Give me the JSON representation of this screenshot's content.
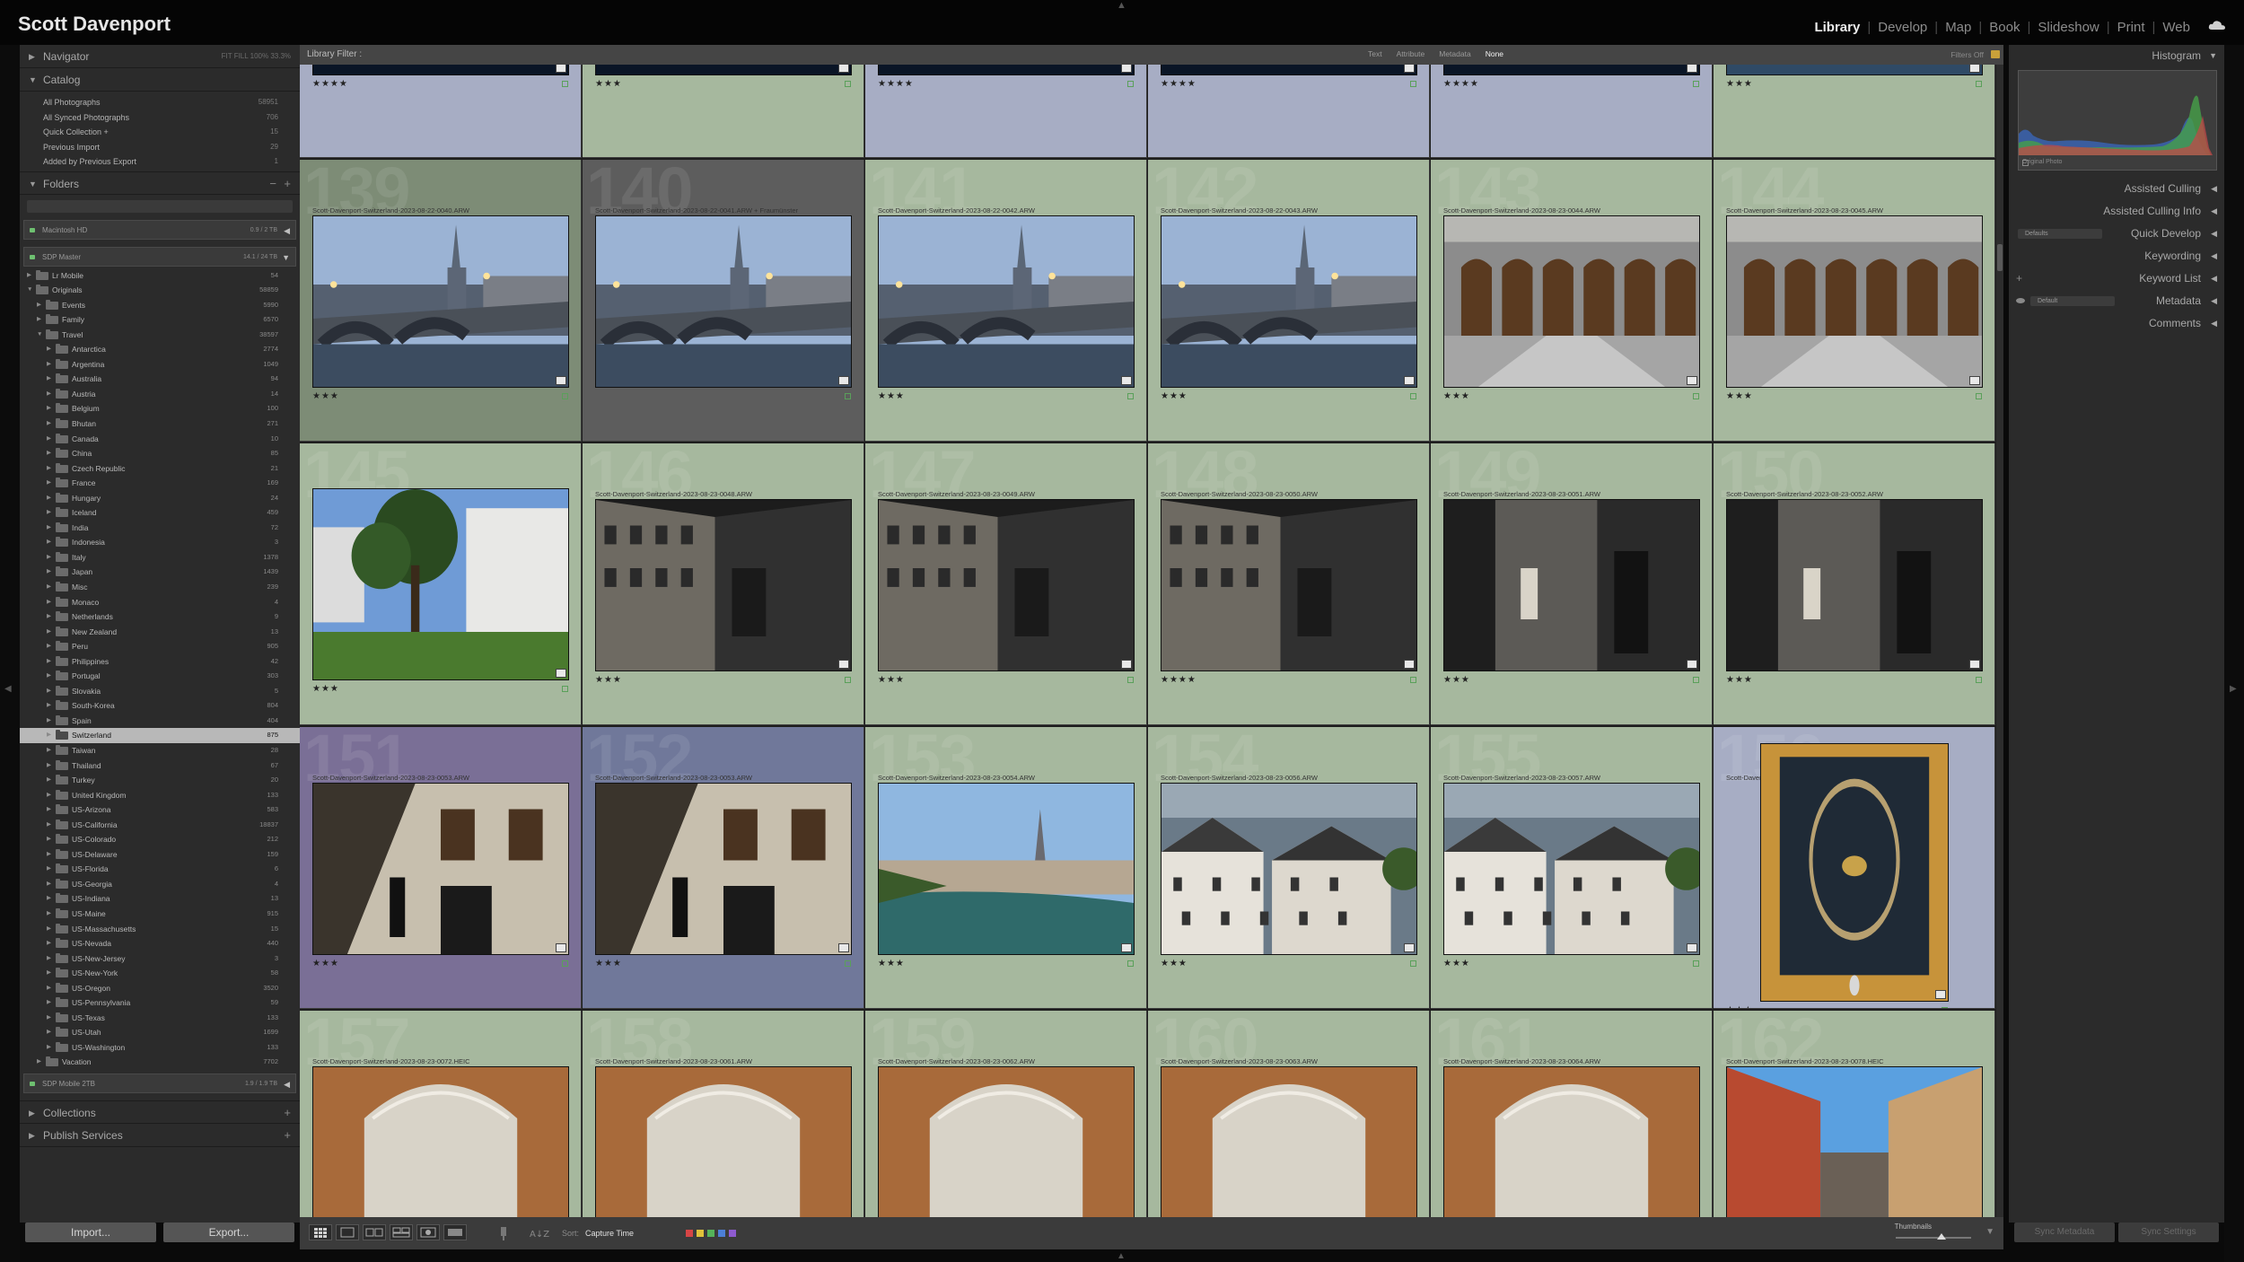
{
  "identity": "Scott Davenport",
  "modules": [
    {
      "label": "Library",
      "active": true
    },
    {
      "label": "Develop"
    },
    {
      "label": "Map"
    },
    {
      "label": "Book"
    },
    {
      "label": "Slideshow"
    },
    {
      "label": "Print"
    },
    {
      "label": "Web"
    }
  ],
  "left_panel": {
    "navigator": {
      "label": "Navigator",
      "zoom": "FIT  FILL  100%  33.3%"
    },
    "catalog": {
      "label": "Catalog",
      "items": [
        {
          "label": "All Photographs",
          "count": "58951"
        },
        {
          "label": "All Synced Photographs",
          "count": "706"
        },
        {
          "label": "Quick Collection +",
          "count": "15"
        },
        {
          "label": "Previous Import",
          "count": "29"
        },
        {
          "label": "Added by Previous Export",
          "count": "1"
        }
      ]
    },
    "folders": {
      "label": "Folders",
      "volumes": [
        {
          "label": "Macintosh HD",
          "info": "0.9 / 2 TB"
        },
        {
          "label": "SDP Master",
          "info": "14.1 / 24 TB"
        },
        {
          "label": "SDP Mobile 2TB",
          "info": "1.9 / 1.9 TB"
        }
      ],
      "tree": [
        {
          "name": "Lr Mobile",
          "count": "54",
          "level": 1
        },
        {
          "name": "Originals",
          "count": "58859",
          "level": 1,
          "open": true
        },
        {
          "name": "Events",
          "count": "5990",
          "level": 2
        },
        {
          "name": "Family",
          "count": "6570",
          "level": 2
        },
        {
          "name": "Travel",
          "count": "38597",
          "level": 2,
          "open": true
        },
        {
          "name": "Antarctica",
          "count": "2774",
          "level": 3
        },
        {
          "name": "Argentina",
          "count": "1049",
          "level": 3
        },
        {
          "name": "Australia",
          "count": "94",
          "level": 3
        },
        {
          "name": "Austria",
          "count": "14",
          "level": 3
        },
        {
          "name": "Belgium",
          "count": "100",
          "level": 3
        },
        {
          "name": "Bhutan",
          "count": "271",
          "level": 3
        },
        {
          "name": "Canada",
          "count": "10",
          "level": 3
        },
        {
          "name": "China",
          "count": "85",
          "level": 3
        },
        {
          "name": "Czech Republic",
          "count": "21",
          "level": 3
        },
        {
          "name": "France",
          "count": "169",
          "level": 3
        },
        {
          "name": "Hungary",
          "count": "24",
          "level": 3
        },
        {
          "name": "Iceland",
          "count": "459",
          "level": 3
        },
        {
          "name": "India",
          "count": "72",
          "level": 3
        },
        {
          "name": "Indonesia",
          "count": "3",
          "level": 3
        },
        {
          "name": "Italy",
          "count": "1378",
          "level": 3
        },
        {
          "name": "Japan",
          "count": "1439",
          "level": 3
        },
        {
          "name": "Misc",
          "count": "239",
          "level": 3
        },
        {
          "name": "Monaco",
          "count": "4",
          "level": 3
        },
        {
          "name": "Netherlands",
          "count": "9",
          "level": 3
        },
        {
          "name": "New Zealand",
          "count": "13",
          "level": 3
        },
        {
          "name": "Peru",
          "count": "905",
          "level": 3
        },
        {
          "name": "Philippines",
          "count": "42",
          "level": 3
        },
        {
          "name": "Portugal",
          "count": "303",
          "level": 3
        },
        {
          "name": "Slovakia",
          "count": "5",
          "level": 3
        },
        {
          "name": "South-Korea",
          "count": "804",
          "level": 3
        },
        {
          "name": "Spain",
          "count": "404",
          "level": 3
        },
        {
          "name": "Switzerland",
          "count": "875",
          "level": 3,
          "selected": true
        },
        {
          "name": "Taiwan",
          "count": "28",
          "level": 3
        },
        {
          "name": "Thailand",
          "count": "67",
          "level": 3
        },
        {
          "name": "Turkey",
          "count": "20",
          "level": 3
        },
        {
          "name": "United Kingdom",
          "count": "133",
          "level": 3
        },
        {
          "name": "US-Arizona",
          "count": "583",
          "level": 3
        },
        {
          "name": "US-California",
          "count": "18837",
          "level": 3
        },
        {
          "name": "US-Colorado",
          "count": "212",
          "level": 3
        },
        {
          "name": "US-Delaware",
          "count": "159",
          "level": 3
        },
        {
          "name": "US-Florida",
          "count": "6",
          "level": 3
        },
        {
          "name": "US-Georgia",
          "count": "4",
          "level": 3
        },
        {
          "name": "US-Indiana",
          "count": "13",
          "level": 3
        },
        {
          "name": "US-Maine",
          "count": "915",
          "level": 3
        },
        {
          "name": "US-Massachusetts",
          "count": "15",
          "level": 3
        },
        {
          "name": "US-Nevada",
          "count": "440",
          "level": 3
        },
        {
          "name": "US-New-Jersey",
          "count": "3",
          "level": 3
        },
        {
          "name": "US-New-York",
          "count": "58",
          "level": 3
        },
        {
          "name": "US-Oregon",
          "count": "3520",
          "level": 3
        },
        {
          "name": "US-Pennsylvania",
          "count": "59",
          "level": 3
        },
        {
          "name": "US-Texas",
          "count": "133",
          "level": 3
        },
        {
          "name": "US-Utah",
          "count": "1699",
          "level": 3
        },
        {
          "name": "US-Washington",
          "count": "133",
          "level": 3
        },
        {
          "name": "Vacation",
          "count": "7702",
          "level": 2
        }
      ]
    },
    "collections": {
      "label": "Collections"
    },
    "publish": {
      "label": "Publish Services"
    },
    "import_label": "Import...",
    "export_label": "Export..."
  },
  "filter_bar": {
    "title": "Library Filter :",
    "options": [
      "Text",
      "Attribute",
      "Metadata",
      "None"
    ],
    "active": "None",
    "status": "Filters Off"
  },
  "grid": {
    "rows": [
      [
        {
          "idx": "",
          "file": "",
          "stars": "★★★★",
          "bg": "#a7adc4",
          "scene": "night"
        },
        {
          "idx": "",
          "file": "",
          "stars": "★★★",
          "bg": "#a6b89e",
          "scene": "night"
        },
        {
          "idx": "",
          "file": "",
          "stars": "★★★★",
          "bg": "#a7adc4",
          "scene": "night"
        },
        {
          "idx": "",
          "file": "",
          "stars": "★★★★",
          "bg": "#a7adc4",
          "scene": "night"
        },
        {
          "idx": "",
          "file": "",
          "stars": "★★★★",
          "bg": "#a7adc4",
          "scene": "night"
        },
        {
          "idx": "",
          "file": "",
          "stars": "★★★",
          "bg": "#a6b89e",
          "scene": "river"
        }
      ],
      [
        {
          "idx": "139",
          "file": "Scott-Davenport-Switzerland-2023-08-22-0040.ARW",
          "stars": "★★★",
          "bg": "#7d8c76",
          "scene": "dusk"
        },
        {
          "idx": "140",
          "file": "Scott-Davenport-Switzerland-2023-08-22-0041.ARW  + Fraumünster",
          "stars": "",
          "bg": "#5d5d5d",
          "scene": "dusk"
        },
        {
          "idx": "141",
          "file": "Scott-Davenport-Switzerland-2023-08-22-0042.ARW",
          "stars": "★★★",
          "bg": "#a6b89e",
          "scene": "dusk"
        },
        {
          "idx": "142",
          "file": "Scott-Davenport-Switzerland-2023-08-22-0043.ARW",
          "stars": "★★★",
          "bg": "#a6b89e",
          "scene": "dusk"
        },
        {
          "idx": "143",
          "file": "Scott-Davenport-Switzerland-2023-08-23-0044.ARW",
          "stars": "★★★",
          "bg": "#a6b89e",
          "scene": "hall"
        },
        {
          "idx": "144",
          "file": "Scott-Davenport-Switzerland-2023-08-23-0045.ARW",
          "stars": "★★★",
          "bg": "#a6b89e",
          "scene": "hall"
        }
      ],
      [
        {
          "idx": "145",
          "file": "Scott-Davenport-Switzerland-2023-08-23-0065.HEIC",
          "stars": "★★★",
          "bg": "#a6b89e",
          "scene": "tree"
        },
        {
          "idx": "146",
          "file": "Scott-Davenport-Switzerland-2023-08-23-0048.ARW",
          "stars": "★★★",
          "bg": "#a6b89e",
          "scene": "street"
        },
        {
          "idx": "147",
          "file": "Scott-Davenport-Switzerland-2023-08-23-0049.ARW",
          "stars": "★★★",
          "bg": "#a6b89e",
          "scene": "street"
        },
        {
          "idx": "148",
          "file": "Scott-Davenport-Switzerland-2023-08-23-0050.ARW",
          "stars": "★★★★",
          "bg": "#a6b89e",
          "scene": "street"
        },
        {
          "idx": "149",
          "file": "Scott-Davenport-Switzerland-2023-08-23-0051.ARW",
          "stars": "★★★",
          "bg": "#a6b89e",
          "scene": "doorway"
        },
        {
          "idx": "150",
          "file": "Scott-Davenport-Switzerland-2023-08-23-0052.ARW",
          "stars": "★★★",
          "bg": "#a6b89e",
          "scene": "doorway"
        }
      ],
      [
        {
          "idx": "151",
          "file": "Scott-Davenport-Switzerland-2023-08-23-0053.ARW",
          "stars": "★★★",
          "bg": "#7a6f96",
          "scene": "sunwall"
        },
        {
          "idx": "152",
          "file": "Scott-Davenport-Switzerland-2023-08-23-0053.ARW",
          "stars": "★★★",
          "bg": "#70789a",
          "scene": "sunwall"
        },
        {
          "idx": "153",
          "file": "Scott-Davenport-Switzerland-2023-08-23-0054.ARW",
          "stars": "★★★",
          "bg": "#a6b89e",
          "scene": "city"
        },
        {
          "idx": "154",
          "file": "Scott-Davenport-Switzerland-2023-08-23-0056.ARW",
          "stars": "★★★",
          "bg": "#a6b89e",
          "scene": "roofs"
        },
        {
          "idx": "155",
          "file": "Scott-Davenport-Switzerland-2023-08-23-0057.ARW",
          "stars": "★★★",
          "bg": "#a6b89e",
          "scene": "roofs"
        },
        {
          "idx": "156",
          "file": "Scott-Davenport-Switzerland-2023-08-23-0071.HEIC",
          "stars": "★★★",
          "bg": "#a7adc4",
          "scene": "door"
        }
      ],
      [
        {
          "idx": "157",
          "file": "Scott-Davenport-Switzerland-2023-08-23-0072.HEIC",
          "stars": "",
          "bg": "#a6b89e",
          "scene": "vault"
        },
        {
          "idx": "158",
          "file": "Scott-Davenport-Switzerland-2023-08-23-0061.ARW",
          "stars": "",
          "bg": "#a6b89e",
          "scene": "vault"
        },
        {
          "idx": "159",
          "file": "Scott-Davenport-Switzerland-2023-08-23-0062.ARW",
          "stars": "",
          "bg": "#a6b89e",
          "scene": "vault"
        },
        {
          "idx": "160",
          "file": "Scott-Davenport-Switzerland-2023-08-23-0063.ARW",
          "stars": "",
          "bg": "#a6b89e",
          "scene": "vault"
        },
        {
          "idx": "161",
          "file": "Scott-Davenport-Switzerland-2023-08-23-0064.ARW",
          "stars": "",
          "bg": "#a6b89e",
          "scene": "vault"
        },
        {
          "idx": "162",
          "file": "Scott-Davenport-Switzerland-2023-08-23-0078.HEIC",
          "stars": "",
          "bg": "#a6b89e",
          "scene": "alley"
        }
      ]
    ]
  },
  "toolbar": {
    "sort_label": "Sort:",
    "sort_value": "Capture Time",
    "thumbnails_label": "Thumbnails",
    "color_labels": [
      "#d64545",
      "#e0c23a",
      "#55b35a",
      "#4c7fd6",
      "#8e5bd0"
    ]
  },
  "right_panel": {
    "histogram": {
      "label": "Histogram",
      "original": "Original Photo"
    },
    "sections": [
      {
        "label": "Assisted Culling"
      },
      {
        "label": "Assisted Culling Info"
      },
      {
        "label": "Quick Develop",
        "select": "Defaults"
      },
      {
        "label": "Keywording"
      },
      {
        "label": "Keyword List"
      },
      {
        "label": "Metadata",
        "select": "Default"
      },
      {
        "label": "Comments"
      }
    ],
    "sync_metadata": "Sync Metadata",
    "sync_settings": "Sync Settings"
  }
}
